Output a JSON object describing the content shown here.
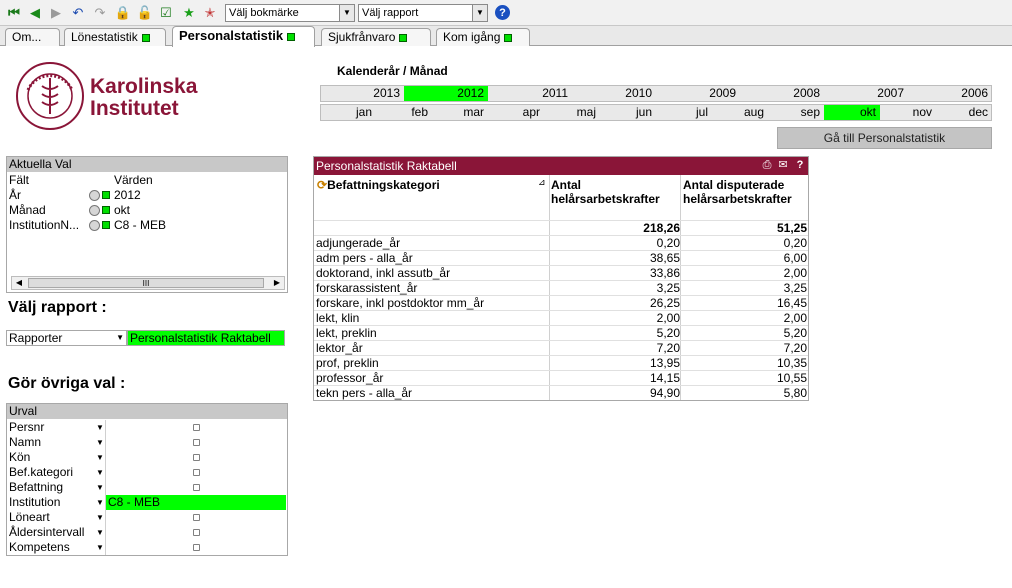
{
  "toolbar": {
    "bookmark_select": "Välj bokmärke",
    "report_select": "Välj rapport"
  },
  "tabs": [
    {
      "label": "Om..."
    },
    {
      "label": "Lönestatistik"
    },
    {
      "label": "Personalstatistik"
    },
    {
      "label": "Sjukfrånvaro"
    },
    {
      "label": "Kom igång"
    }
  ],
  "logo": {
    "line1": "Karolinska",
    "line2": "Institutet"
  },
  "calendar": {
    "label": "Kalenderår / Månad",
    "years": [
      "2013",
      "2012",
      "2011",
      "2010",
      "2009",
      "2008",
      "2007",
      "2006"
    ],
    "selected_year": "2012",
    "months": [
      "jan",
      "feb",
      "mar",
      "apr",
      "maj",
      "jun",
      "jul",
      "aug",
      "sep",
      "okt",
      "nov",
      "dec"
    ],
    "selected_month": "okt"
  },
  "goto_button": "Gå till Personalstatistik",
  "aktuella_val": {
    "title": "Aktuella Val",
    "col_field": "Fält",
    "col_values": "Värden",
    "rows": [
      {
        "field": "År",
        "value": "2012"
      },
      {
        "field": "Månad",
        "value": "okt"
      },
      {
        "field": "InstitutionN...",
        "value": "C8 - MEB"
      }
    ],
    "scroll_glyph": "III"
  },
  "valj_rapport": {
    "heading": "Välj rapport :",
    "select_label": "Rapporter",
    "selected_value": "Personalstatistik Raktabell"
  },
  "gor_ovriga_val": {
    "heading": "Gör övriga val :"
  },
  "urval": {
    "title": "Urval",
    "rows": [
      {
        "label": "Persnr",
        "value": ""
      },
      {
        "label": "Namn",
        "value": ""
      },
      {
        "label": "Kön",
        "value": ""
      },
      {
        "label": "Bef.kategori",
        "value": ""
      },
      {
        "label": "Befattning",
        "value": ""
      },
      {
        "label": "Institution",
        "value": "C8 - MEB"
      },
      {
        "label": "Löneart",
        "value": ""
      },
      {
        "label": "Åldersintervall",
        "value": ""
      },
      {
        "label": "Kompetens",
        "value": ""
      }
    ]
  },
  "table": {
    "title": "Personalstatistik Raktabell",
    "col1": "Befattningskategori",
    "col2_line1": "Antal",
    "col2_line2": "helårsarbetskrafter",
    "col3_line1": "Antal disputerade",
    "col3_line2": "helårsarbetskrafter",
    "total2": "218,26",
    "total3": "51,25",
    "rows": [
      {
        "cat": "adjungerade_år",
        "v1": "0,20",
        "v2": "0,20"
      },
      {
        "cat": "adm pers - alla_år",
        "v1": "38,65",
        "v2": "6,00"
      },
      {
        "cat": "doktorand, inkl assutb_år",
        "v1": "33,86",
        "v2": "2,00"
      },
      {
        "cat": "forskarassistent_år",
        "v1": "3,25",
        "v2": "3,25"
      },
      {
        "cat": "forskare, inkl postdoktor mm_år",
        "v1": "26,25",
        "v2": "16,45"
      },
      {
        "cat": "lekt, klin",
        "v1": "2,00",
        "v2": "2,00"
      },
      {
        "cat": "lekt, preklin",
        "v1": "5,20",
        "v2": "5,20"
      },
      {
        "cat": "lektor_år",
        "v1": "7,20",
        "v2": "7,20"
      },
      {
        "cat": "prof, preklin",
        "v1": "13,95",
        "v2": "10,35"
      },
      {
        "cat": "professor_år",
        "v1": "14,15",
        "v2": "10,55"
      },
      {
        "cat": "tekn pers - alla_år",
        "v1": "94,90",
        "v2": "5,80"
      }
    ]
  }
}
